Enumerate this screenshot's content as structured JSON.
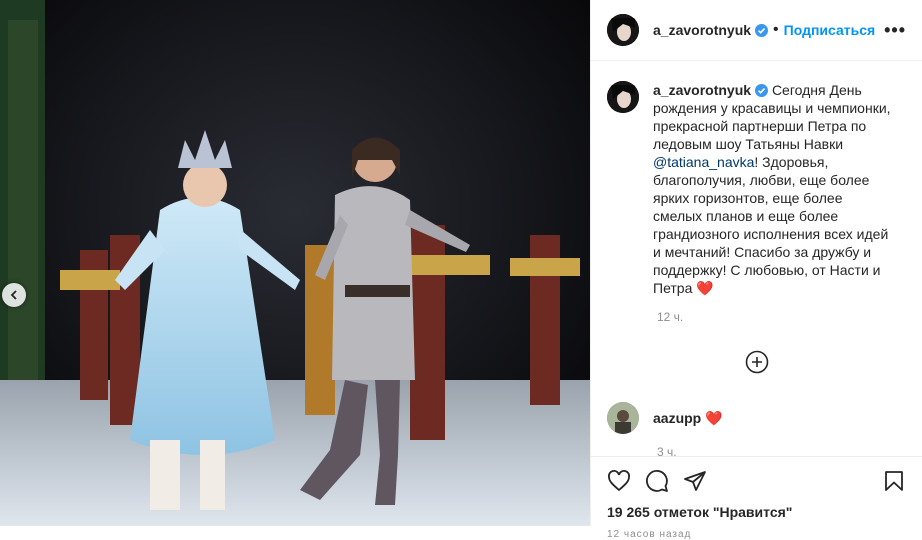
{
  "post": {
    "author": "a_zavorotnyuk",
    "follow_label": "Подписаться",
    "caption_text": "Сегодня День рождения у красавицы и чемпионки, прекрасной партнерши Петра по ледовым шоу Татьяны Навки ",
    "mention": "@tatiana_navka",
    "caption_text_2": "! Здоровья, благополучия, любви, еще более ярких горизонтов, еще более смелых планов и еще более грандиозного исполнения всех идей и мечтаний! Спасибо за дружбу и поддержку! С любовью, от Насти и Петра ",
    "heart_emoji": "❤️",
    "caption_time": "12 ч.",
    "likes": "19 265 отметок \"Нравится\"",
    "cutoff_text": "12 часов назад"
  },
  "comments": [
    {
      "user": "aazupp",
      "emoji": "❤️",
      "time": "3 ч."
    }
  ],
  "colors": {
    "link": "#0095f6",
    "muted": "#8e8e8e",
    "heart": "#ed4956"
  },
  "icons": [
    "verified-badge-icon",
    "more-options-icon",
    "add-comment-icon",
    "like-icon",
    "comment-icon",
    "share-icon",
    "save-icon",
    "carousel-prev-icon"
  ]
}
